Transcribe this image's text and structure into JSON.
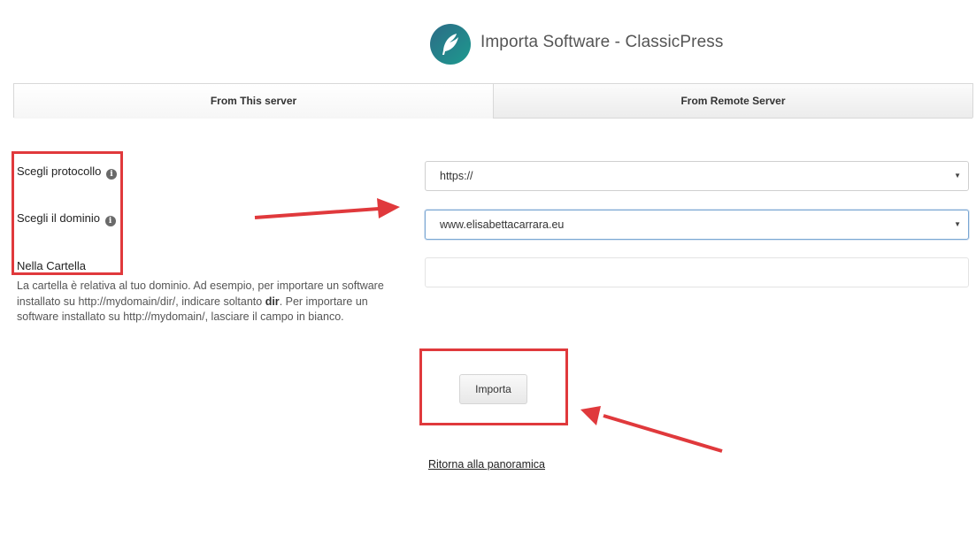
{
  "header": {
    "title": "Importa Software - ClassicPress",
    "logo_icon": "feather-icon"
  },
  "tabs": [
    {
      "label": "From This server",
      "active": true
    },
    {
      "label": "From Remote Server",
      "active": false
    }
  ],
  "form": {
    "protocol": {
      "label": "Scegli protocollo",
      "value": "https://"
    },
    "domain": {
      "label": "Scegli il dominio",
      "value": "www.elisabettacarrara.eu"
    },
    "directory": {
      "label": "Nella Cartella",
      "value": "",
      "help_part1": "La cartella è relativa al tuo dominio. Ad esempio, per importare un software installato su http://mydomain/dir/, indicare soltanto ",
      "help_bold": "dir",
      "help_part2": ". Per importare un software installato su http://mydomain/, lasciare il campo in bianco."
    },
    "info_icon": "i"
  },
  "actions": {
    "import_label": "Importa",
    "back_link": "Ritorna alla panoramica"
  },
  "colors": {
    "annotation": "#e0393c",
    "logo_start": "#2c6b86",
    "logo_end": "#1d9a8f"
  }
}
